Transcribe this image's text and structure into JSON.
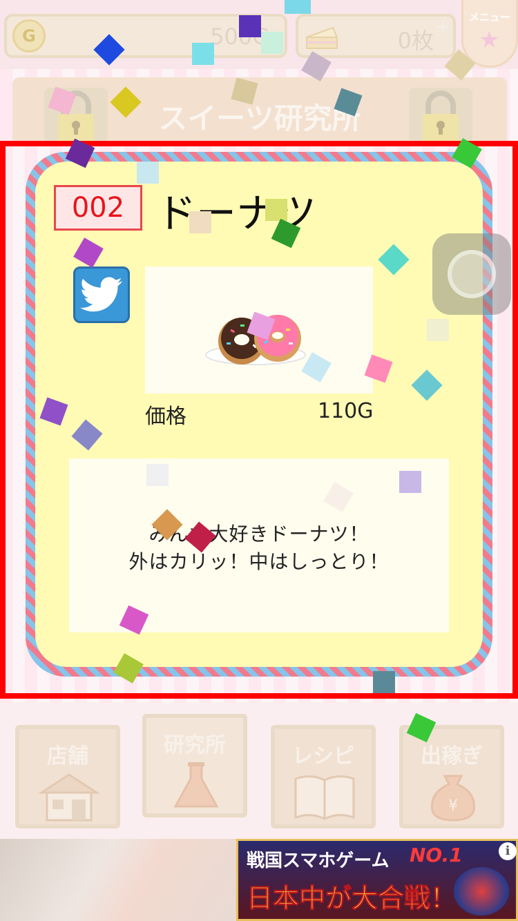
{
  "header": {
    "coin_value": "500G",
    "coin_symbol": "G",
    "ticket_value": "0枚",
    "plus_symbol": "+",
    "menu_label": "メニュー"
  },
  "screen_title": "スイーツ研究所",
  "card": {
    "id": "002",
    "name": "ドーナツ",
    "price_label": "価格",
    "price_value": "110G",
    "description_line1": "みんな大好きドーナツ！",
    "description_line2": "外はカリッ！中はしっとり！"
  },
  "nav": {
    "store": "店舗",
    "lab": "研究所",
    "recipe": "レシピ",
    "work": "出稼ぎ"
  },
  "ad": {
    "line1": "戦国スマホゲーム",
    "no1": "NO.1",
    "line2": "日本中が大合戦！",
    "info": "i"
  },
  "colors": {
    "highlight_frame": "#ff0000",
    "card_background": "#fffbb4",
    "id_badge_text": "#e8141c",
    "twitter_blue": "#3a97d8"
  }
}
